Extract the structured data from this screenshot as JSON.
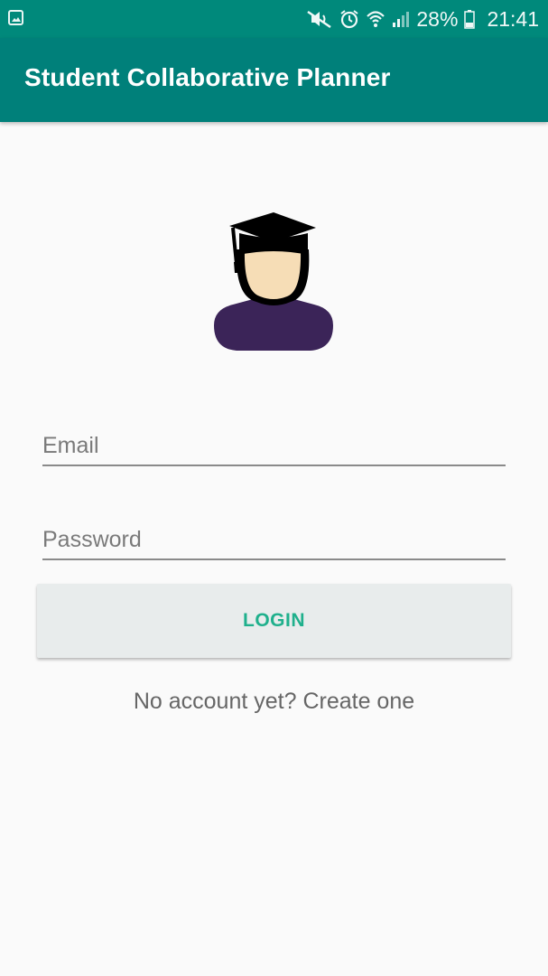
{
  "status_bar": {
    "left_icon": "image-notification-icon",
    "icons": [
      "mute-icon",
      "alarm-icon",
      "wifi-icon",
      "signal-icon",
      "battery-icon"
    ],
    "battery": "28%",
    "time": "21:41"
  },
  "app_bar": {
    "title": "Student Collaborative Planner",
    "color": "#00807a"
  },
  "avatar": {
    "icon": "student-graduate-avatar-icon"
  },
  "form": {
    "email_placeholder": "Email",
    "email_value": "",
    "password_placeholder": "Password",
    "password_value": ""
  },
  "login_button": {
    "label": "LOGIN",
    "color": "#1fb08c"
  },
  "signup_link": {
    "text": "No account yet? Create one"
  }
}
